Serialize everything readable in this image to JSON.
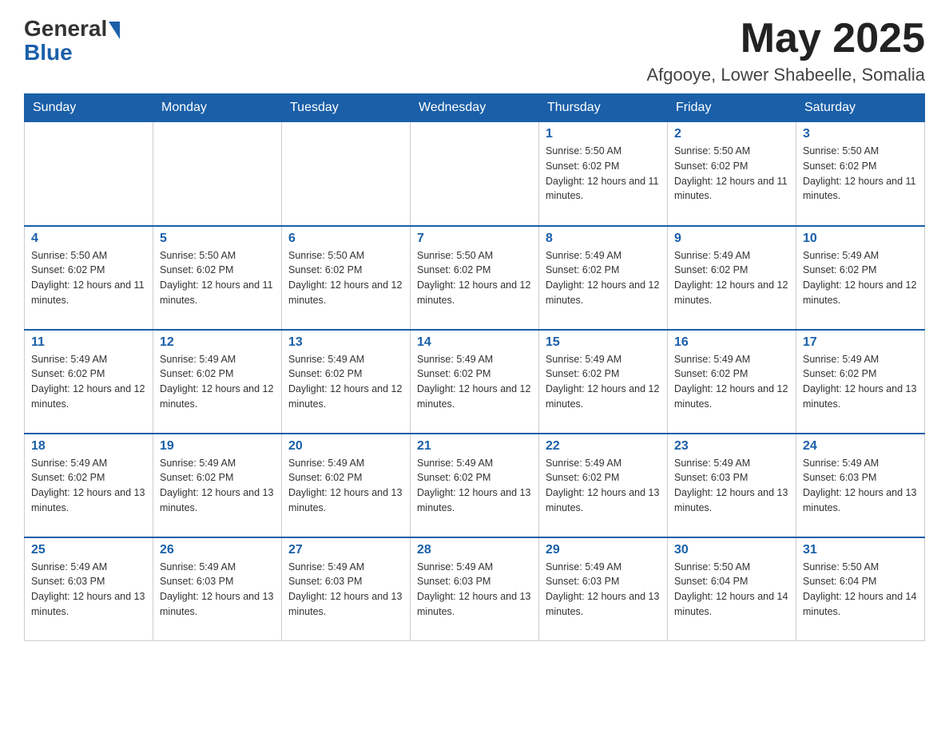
{
  "header": {
    "logo_general": "General",
    "logo_blue": "Blue",
    "month_year": "May 2025",
    "location": "Afgooye, Lower Shabeelle, Somalia"
  },
  "days_of_week": [
    "Sunday",
    "Monday",
    "Tuesday",
    "Wednesday",
    "Thursday",
    "Friday",
    "Saturday"
  ],
  "weeks": [
    [
      {
        "day": "",
        "info": ""
      },
      {
        "day": "",
        "info": ""
      },
      {
        "day": "",
        "info": ""
      },
      {
        "day": "",
        "info": ""
      },
      {
        "day": "1",
        "info": "Sunrise: 5:50 AM\nSunset: 6:02 PM\nDaylight: 12 hours and 11 minutes."
      },
      {
        "day": "2",
        "info": "Sunrise: 5:50 AM\nSunset: 6:02 PM\nDaylight: 12 hours and 11 minutes."
      },
      {
        "day": "3",
        "info": "Sunrise: 5:50 AM\nSunset: 6:02 PM\nDaylight: 12 hours and 11 minutes."
      }
    ],
    [
      {
        "day": "4",
        "info": "Sunrise: 5:50 AM\nSunset: 6:02 PM\nDaylight: 12 hours and 11 minutes."
      },
      {
        "day": "5",
        "info": "Sunrise: 5:50 AM\nSunset: 6:02 PM\nDaylight: 12 hours and 11 minutes."
      },
      {
        "day": "6",
        "info": "Sunrise: 5:50 AM\nSunset: 6:02 PM\nDaylight: 12 hours and 12 minutes."
      },
      {
        "day": "7",
        "info": "Sunrise: 5:50 AM\nSunset: 6:02 PM\nDaylight: 12 hours and 12 minutes."
      },
      {
        "day": "8",
        "info": "Sunrise: 5:49 AM\nSunset: 6:02 PM\nDaylight: 12 hours and 12 minutes."
      },
      {
        "day": "9",
        "info": "Sunrise: 5:49 AM\nSunset: 6:02 PM\nDaylight: 12 hours and 12 minutes."
      },
      {
        "day": "10",
        "info": "Sunrise: 5:49 AM\nSunset: 6:02 PM\nDaylight: 12 hours and 12 minutes."
      }
    ],
    [
      {
        "day": "11",
        "info": "Sunrise: 5:49 AM\nSunset: 6:02 PM\nDaylight: 12 hours and 12 minutes."
      },
      {
        "day": "12",
        "info": "Sunrise: 5:49 AM\nSunset: 6:02 PM\nDaylight: 12 hours and 12 minutes."
      },
      {
        "day": "13",
        "info": "Sunrise: 5:49 AM\nSunset: 6:02 PM\nDaylight: 12 hours and 12 minutes."
      },
      {
        "day": "14",
        "info": "Sunrise: 5:49 AM\nSunset: 6:02 PM\nDaylight: 12 hours and 12 minutes."
      },
      {
        "day": "15",
        "info": "Sunrise: 5:49 AM\nSunset: 6:02 PM\nDaylight: 12 hours and 12 minutes."
      },
      {
        "day": "16",
        "info": "Sunrise: 5:49 AM\nSunset: 6:02 PM\nDaylight: 12 hours and 12 minutes."
      },
      {
        "day": "17",
        "info": "Sunrise: 5:49 AM\nSunset: 6:02 PM\nDaylight: 12 hours and 13 minutes."
      }
    ],
    [
      {
        "day": "18",
        "info": "Sunrise: 5:49 AM\nSunset: 6:02 PM\nDaylight: 12 hours and 13 minutes."
      },
      {
        "day": "19",
        "info": "Sunrise: 5:49 AM\nSunset: 6:02 PM\nDaylight: 12 hours and 13 minutes."
      },
      {
        "day": "20",
        "info": "Sunrise: 5:49 AM\nSunset: 6:02 PM\nDaylight: 12 hours and 13 minutes."
      },
      {
        "day": "21",
        "info": "Sunrise: 5:49 AM\nSunset: 6:02 PM\nDaylight: 12 hours and 13 minutes."
      },
      {
        "day": "22",
        "info": "Sunrise: 5:49 AM\nSunset: 6:02 PM\nDaylight: 12 hours and 13 minutes."
      },
      {
        "day": "23",
        "info": "Sunrise: 5:49 AM\nSunset: 6:03 PM\nDaylight: 12 hours and 13 minutes."
      },
      {
        "day": "24",
        "info": "Sunrise: 5:49 AM\nSunset: 6:03 PM\nDaylight: 12 hours and 13 minutes."
      }
    ],
    [
      {
        "day": "25",
        "info": "Sunrise: 5:49 AM\nSunset: 6:03 PM\nDaylight: 12 hours and 13 minutes."
      },
      {
        "day": "26",
        "info": "Sunrise: 5:49 AM\nSunset: 6:03 PM\nDaylight: 12 hours and 13 minutes."
      },
      {
        "day": "27",
        "info": "Sunrise: 5:49 AM\nSunset: 6:03 PM\nDaylight: 12 hours and 13 minutes."
      },
      {
        "day": "28",
        "info": "Sunrise: 5:49 AM\nSunset: 6:03 PM\nDaylight: 12 hours and 13 minutes."
      },
      {
        "day": "29",
        "info": "Sunrise: 5:49 AM\nSunset: 6:03 PM\nDaylight: 12 hours and 13 minutes."
      },
      {
        "day": "30",
        "info": "Sunrise: 5:50 AM\nSunset: 6:04 PM\nDaylight: 12 hours and 14 minutes."
      },
      {
        "day": "31",
        "info": "Sunrise: 5:50 AM\nSunset: 6:04 PM\nDaylight: 12 hours and 14 minutes."
      }
    ]
  ]
}
